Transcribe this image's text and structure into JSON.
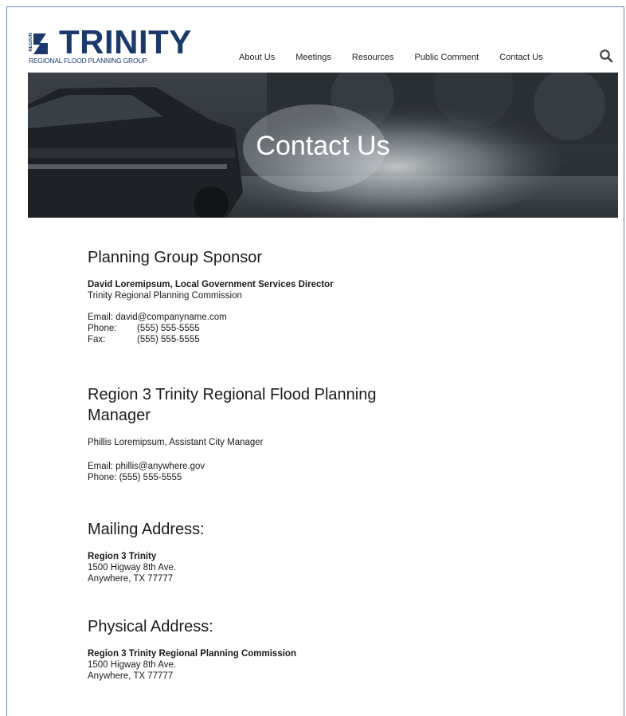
{
  "header": {
    "logo": {
      "region": "REGION",
      "title": "TRINITY",
      "subtitle": "REGIONAL FLOOD PLANNING GROUP"
    },
    "nav": [
      {
        "label": "About Us"
      },
      {
        "label": "Meetings"
      },
      {
        "label": "Resources"
      },
      {
        "label": "Public Comment"
      },
      {
        "label": "Contact Us"
      }
    ],
    "search_icon": "search-icon"
  },
  "hero": {
    "title": "Contact Us",
    "image": "car-driving-through-flood-water"
  },
  "sections": {
    "sponsor": {
      "heading": "Planning Group Sponsor",
      "name": "David Loremipsum, Local Government Services Director",
      "org": "Trinity Regional Planning Commission",
      "email_label": "Email:",
      "email": "david@companyname.com",
      "phone_label": "Phone:",
      "phone": "(555) 555-5555",
      "fax_label": "Fax:",
      "fax": "(555) 555-5555"
    },
    "manager": {
      "heading_line1": "Region 3 Trinity Regional Flood Planning",
      "heading_line2": "Manager",
      "name": "Phillis Loremipsum, Assistant City Manager",
      "email_line": "Email: phillis@anywhere.gov",
      "phone_line": "Phone: (555) 555-5555"
    },
    "mailing": {
      "heading": "Mailing Address:",
      "name": "Region 3 Trinity",
      "street": "1500 Higway 8th Ave.",
      "city": "Anywhere, TX 77777"
    },
    "physical": {
      "heading": "Physical Address:",
      "name": "Region 3 Trinity Regional Planning Commission",
      "street": "1500 Higway 8th Ave.",
      "city": "Anywhere, TX 77777"
    }
  },
  "colors": {
    "brand": "#1b3a6b",
    "frame": "#6a86c6",
    "text": "#1a1a1a"
  }
}
